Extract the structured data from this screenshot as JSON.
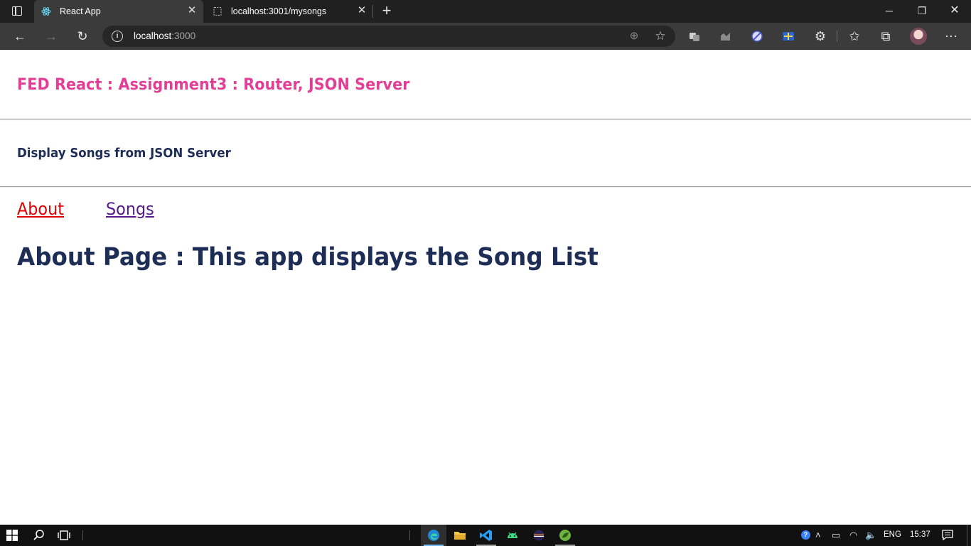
{
  "browser": {
    "tabs": [
      {
        "title": "React App",
        "active": true,
        "icon": "react-icon"
      },
      {
        "title": "localhost:3001/mysongs",
        "active": false,
        "icon": "page-icon"
      }
    ],
    "address": {
      "host": "localhost",
      "port": ":3000"
    },
    "window_controls": [
      "minimize",
      "restore",
      "close"
    ]
  },
  "page": {
    "app_title": "FED React : Assignment3 : Router, JSON Server",
    "sub_title": "Display Songs from JSON Server",
    "nav": {
      "about": "About",
      "songs": "Songs"
    },
    "heading": "About Page : This app displays the Song List"
  },
  "taskbar": {
    "language": "ENG",
    "time": "15:37",
    "pinned_apps": [
      "edge-icon",
      "file-explorer-icon",
      "vscode-icon",
      "android-studio-icon",
      "eclipse-icon",
      "spring-tool-icon"
    ]
  },
  "colors": {
    "app_title": "#e23e96",
    "heading": "#1e2d55",
    "link_active": "#dd0000",
    "link_visited": "#551a8b"
  }
}
